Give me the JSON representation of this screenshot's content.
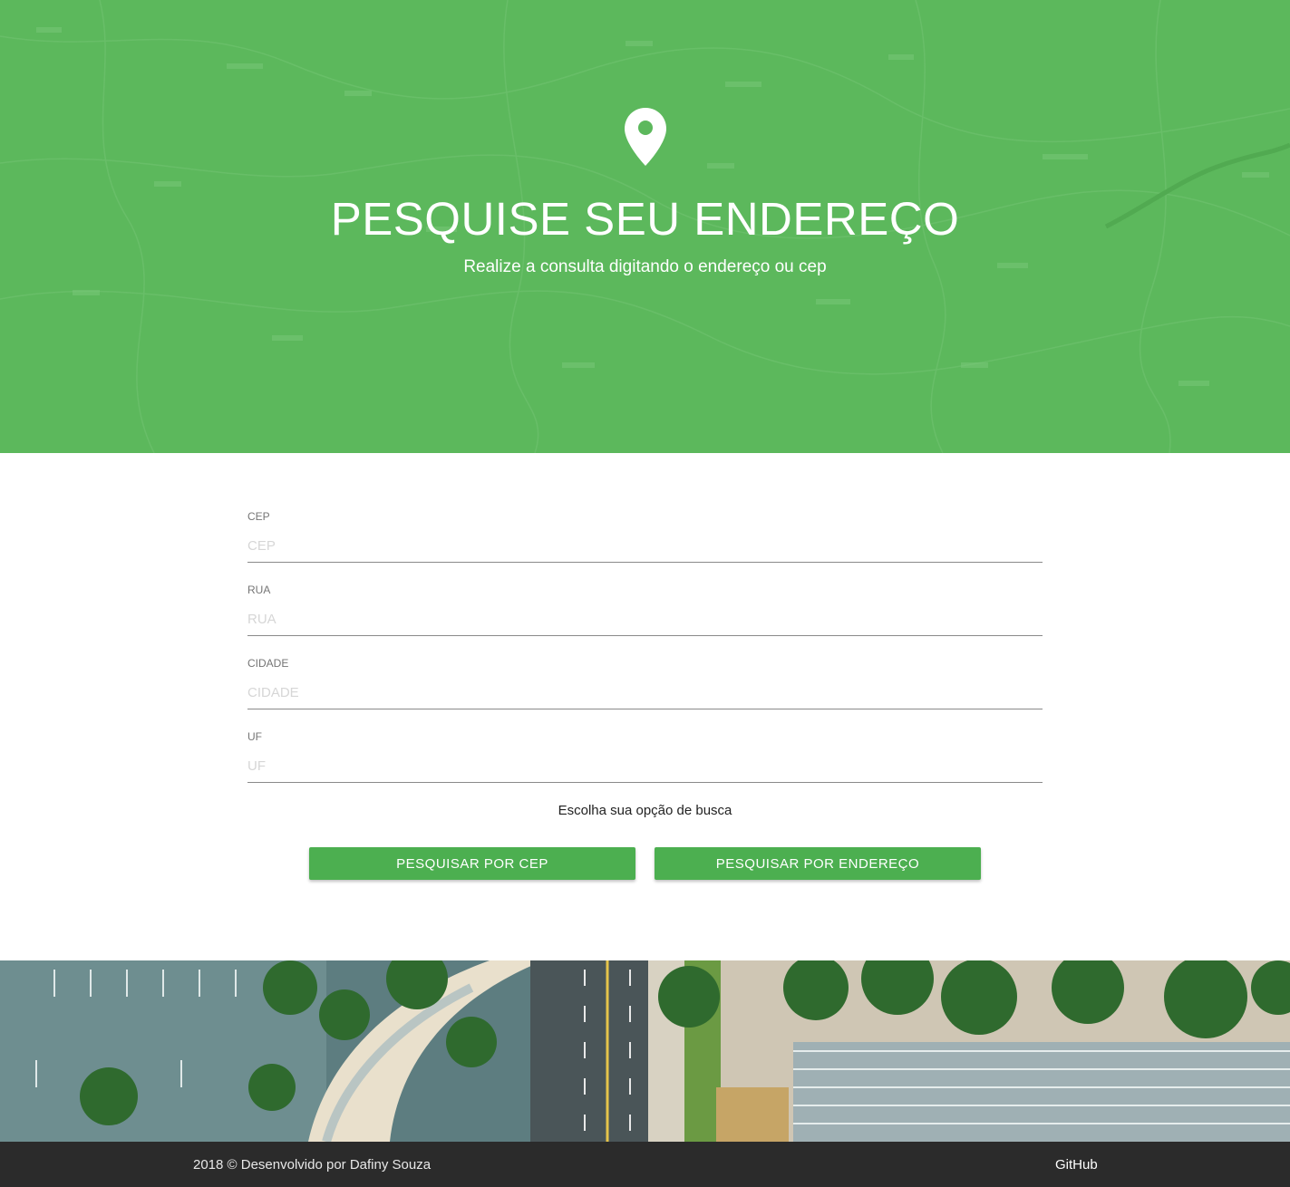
{
  "hero": {
    "title": "PESQUISE SEU ENDEREÇO",
    "subtitle": "Realize a consulta digitando o endereço ou cep",
    "icon": "map-pin-icon",
    "background_color": "#5cb85c"
  },
  "form": {
    "fields": [
      {
        "label": "CEP",
        "placeholder": "CEP",
        "value": ""
      },
      {
        "label": "RUA",
        "placeholder": "RUA",
        "value": ""
      },
      {
        "label": "CIDADE",
        "placeholder": "CIDADE",
        "value": ""
      },
      {
        "label": "UF",
        "placeholder": "UF",
        "value": ""
      }
    ],
    "choose_text": "Escolha sua opção de busca",
    "buttons": {
      "search_cep": "PESQUISAR POR CEP",
      "search_address": "PESQUISAR POR ENDEREÇO"
    },
    "accent_color": "#4caf50"
  },
  "footer": {
    "copyright": "2018 © Desenvolvido por Dafiny Souza",
    "link_label": "GitHub",
    "background_color": "#2b2b2b"
  }
}
